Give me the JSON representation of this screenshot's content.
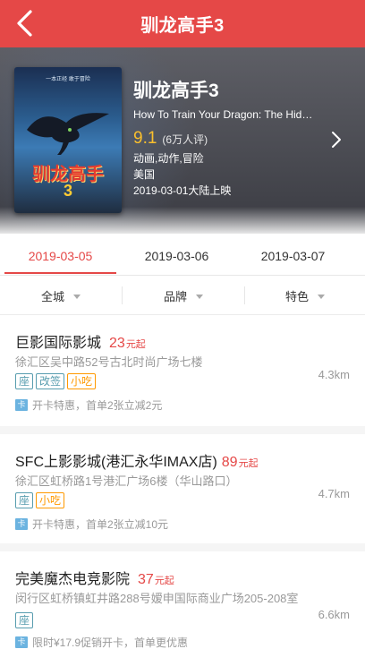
{
  "header": {
    "title": "驯龙高手3"
  },
  "movie": {
    "poster_tagline": "一本正经  敢于冒险",
    "poster_title": "驯龙高手",
    "poster_number": "3",
    "title_cn": "驯龙高手3",
    "title_en": "How To Train Your Dragon: The Hidden World",
    "score": "9.1",
    "votes": "(6万人评)",
    "genres": "动画,动作,冒险",
    "country": "美国",
    "release": "2019-03-01大陆上映"
  },
  "dates": [
    {
      "label": "2019-03-05",
      "active": true
    },
    {
      "label": "2019-03-06",
      "active": false
    },
    {
      "label": "2019-03-07",
      "active": false
    }
  ],
  "filters": [
    "全城",
    "品牌",
    "特色"
  ],
  "cinemas": [
    {
      "name": "巨影国际影城",
      "price": "23",
      "price_unit": "元起",
      "address": "徐汇区吴中路52号古北时尚广场七楼",
      "distance": "4.3km",
      "tags": [
        {
          "label": "座",
          "style": "blue"
        },
        {
          "label": "改签",
          "style": "blue"
        },
        {
          "label": "小吃",
          "style": "orange"
        }
      ],
      "card_label": "卡",
      "promo": "开卡特惠，首单2张立减2元"
    },
    {
      "name": "SFC上影影城(港汇永华IMAX店)",
      "price": "89",
      "price_unit": "元起",
      "address": "徐汇区虹桥路1号港汇广场6楼（华山路口）",
      "distance": "4.7km",
      "tags": [
        {
          "label": "座",
          "style": "blue"
        },
        {
          "label": "小吃",
          "style": "orange"
        }
      ],
      "card_label": "卡",
      "promo": "开卡特惠，首单2张立减10元"
    },
    {
      "name": "完美魔杰电竞影院",
      "price": "37",
      "price_unit": "元起",
      "address": "闵行区虹桥镇虹井路288号嫒申国际商业广场205-208室",
      "distance": "6.6km",
      "tags": [
        {
          "label": "座",
          "style": "blue"
        }
      ],
      "card_label": "卡",
      "promo": "限时¥17.9促销开卡，首单更优惠"
    }
  ],
  "colors": {
    "brand": "#e54847",
    "score": "#fbc02d",
    "tag_blue": "#589daf",
    "tag_orange": "#ff9900",
    "card": "#6bb3e0"
  }
}
